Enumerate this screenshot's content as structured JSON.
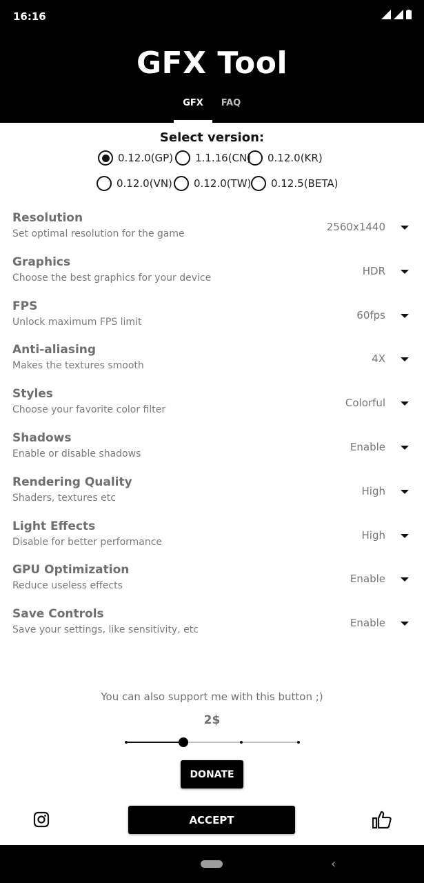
{
  "status": {
    "time": "16:16"
  },
  "header": {
    "title": "GFX Tool"
  },
  "tabs": [
    {
      "label": "GFX",
      "active": true
    },
    {
      "label": "FAQ",
      "active": false
    }
  ],
  "version": {
    "title": "Select version:",
    "options": [
      {
        "label": "0.12.0(GP)",
        "selected": true
      },
      {
        "label": "1.1.16(CN)",
        "selected": false
      },
      {
        "label": "0.12.0(KR)",
        "selected": false
      },
      {
        "label": "0.12.0(VN)",
        "selected": false
      },
      {
        "label": "0.12.0(TW)",
        "selected": false
      },
      {
        "label": "0.12.5(BETA)",
        "selected": false
      }
    ]
  },
  "settings": [
    {
      "title": "Resolution",
      "desc": "Set optimal resolution for the game",
      "value": "2560x1440"
    },
    {
      "title": "Graphics",
      "desc": "Choose the best graphics for your device",
      "value": "HDR"
    },
    {
      "title": "FPS",
      "desc": "Unlock maximum FPS limit",
      "value": "60fps"
    },
    {
      "title": "Anti-aliasing",
      "desc": "Makes the textures smooth",
      "value": "4X"
    },
    {
      "title": "Styles",
      "desc": "Choose your favorite color filter",
      "value": "Colorful"
    },
    {
      "title": "Shadows",
      "desc": "Enable or disable shadows",
      "value": "Enable"
    },
    {
      "title": "Rendering Quality",
      "desc": "Shaders, textures etc",
      "value": "High"
    },
    {
      "title": "Light Effects",
      "desc": "Disable for better performance",
      "value": "High"
    },
    {
      "title": "GPU Optimization",
      "desc": "Reduce useless effects",
      "value": "Enable"
    },
    {
      "title": "Save Controls",
      "desc": "Save your settings, like sensitivity, etc",
      "value": "Enable"
    }
  ],
  "support": {
    "text": "You can also support me with this button ;)",
    "amount": "2$",
    "slider_steps": 4,
    "slider_selected_step": 1,
    "donate_label": "DONATE"
  },
  "footer": {
    "accept_label": "ACCEPT",
    "left_icon": "instagram-icon",
    "right_icon": "thumbs-up-icon"
  }
}
